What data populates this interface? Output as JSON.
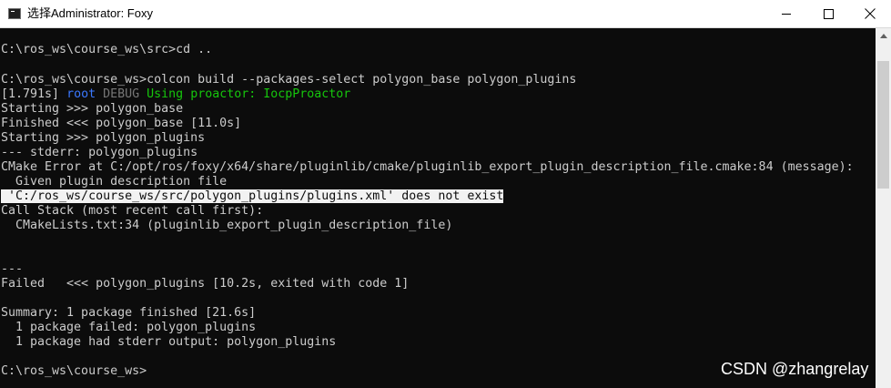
{
  "window": {
    "title": "选择Administrator: Foxy",
    "minimize_icon": "minimize-icon",
    "maximize_icon": "maximize-icon",
    "close_icon": "close-icon",
    "app_icon": "cmd-icon"
  },
  "terminal": {
    "colors": {
      "background": "#0c0c0c",
      "text": "#cccccc",
      "blue": "#3b78ff",
      "gray": "#767676",
      "green": "#16c60c",
      "selection": "#f2f2f2"
    },
    "lines": {
      "l01": "C:\\ros_ws\\course_ws\\src>cd ..",
      "l03": "C:\\ros_ws\\course_ws>colcon build --packages-select polygon_base polygon_plugins",
      "l04_time": "[1.791s]",
      "l04_root": "root",
      "l04_level": "DEBUG",
      "l04_msg": "Using proactor: IocpProactor",
      "l05": "Starting >>> polygon_base",
      "l06": "Finished <<< polygon_base [11.0s]",
      "l07": "Starting >>> polygon_plugins",
      "l08": "--- stderr: polygon_plugins",
      "l09": "CMake Error at C:/opt/ros/foxy/x64/share/pluginlib/cmake/pluginlib_export_plugin_description_file.cmake:84 (message):",
      "l10": "  Given plugin description file",
      "l11": " 'C:/ros_ws/course_ws/src/polygon_plugins/plugins.xml' does not exist",
      "l12": "Call Stack (most recent call first):",
      "l13": "  CMakeLists.txt:34 (pluginlib_export_plugin_description_file)",
      "l16": "---",
      "l17": "Failed   <<< polygon_plugins [10.2s, exited with code 1]",
      "l19": "Summary: 1 package finished [21.6s]",
      "l20": "  1 package failed: polygon_plugins",
      "l21": "  1 package had stderr output: polygon_plugins",
      "l23": "C:\\ros_ws\\course_ws>"
    }
  },
  "watermark": "CSDN @zhangrelay"
}
